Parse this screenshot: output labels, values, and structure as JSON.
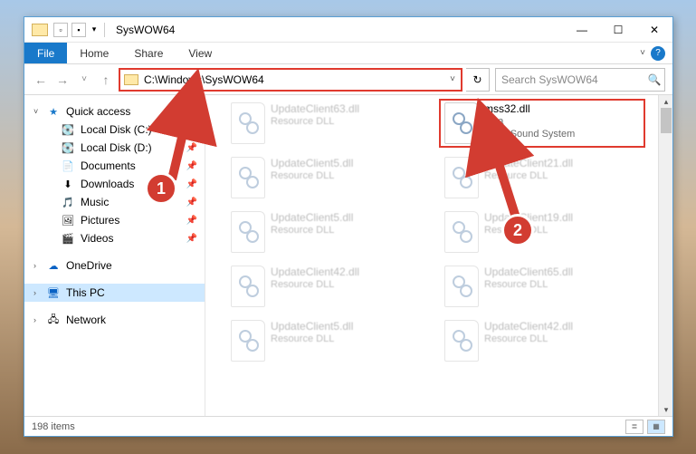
{
  "title": "SysWOW64",
  "ribbon": {
    "file": "File",
    "home": "Home",
    "share": "Share",
    "view": "View"
  },
  "nav": {
    "back": "←",
    "forward": "→",
    "up": "↑",
    "dropdown": "˅"
  },
  "address": {
    "path": "C:\\Windows\\SysWOW64",
    "dropdown": "˅",
    "refresh": "↻"
  },
  "search": {
    "placeholder": "Search SysWOW64",
    "icon": "🔍"
  },
  "sidebar": {
    "quick": "Quick access",
    "items": [
      {
        "label": "Local Disk (C:)",
        "icon": "💽"
      },
      {
        "label": "Local Disk (D:)",
        "icon": "💽"
      },
      {
        "label": "Documents",
        "icon": "📄"
      },
      {
        "label": "Downloads",
        "icon": "⬇"
      },
      {
        "label": "Music",
        "icon": "🎵"
      },
      {
        "label": "Pictures",
        "icon": "🖼"
      },
      {
        "label": "Videos",
        "icon": "🎬"
      }
    ],
    "onedrive": "OneDrive",
    "thispc": "This PC",
    "network": "Network"
  },
  "files": {
    "highlighted": {
      "name": "mss32.dll",
      "version": "9.3a",
      "desc": "Miles Sound System"
    },
    "blur": [
      {
        "name": "UpdateClient63.dll",
        "desc": "Resource DLL"
      },
      {
        "name": "UpdateClient5.dll",
        "desc": "Resource DLL"
      },
      {
        "name": "UpdateClient5.dll",
        "desc": "Resource DLL"
      },
      {
        "name": "UpdateClient42.dll",
        "desc": "Resource DLL"
      },
      {
        "name": "UpdateClient5.dll",
        "desc": "Resource DLL"
      },
      {
        "name": "UpdateClient21.dll",
        "desc": "Resource DLL"
      },
      {
        "name": "UpdateClient19.dll",
        "desc": "Resource DLL"
      },
      {
        "name": "UpdateClient65.dll",
        "desc": "Resource DLL"
      },
      {
        "name": "UpdateClient42.dll",
        "desc": "Resource DLL"
      }
    ]
  },
  "status": {
    "count": "198 items"
  },
  "callouts": {
    "one": "1",
    "two": "2"
  }
}
